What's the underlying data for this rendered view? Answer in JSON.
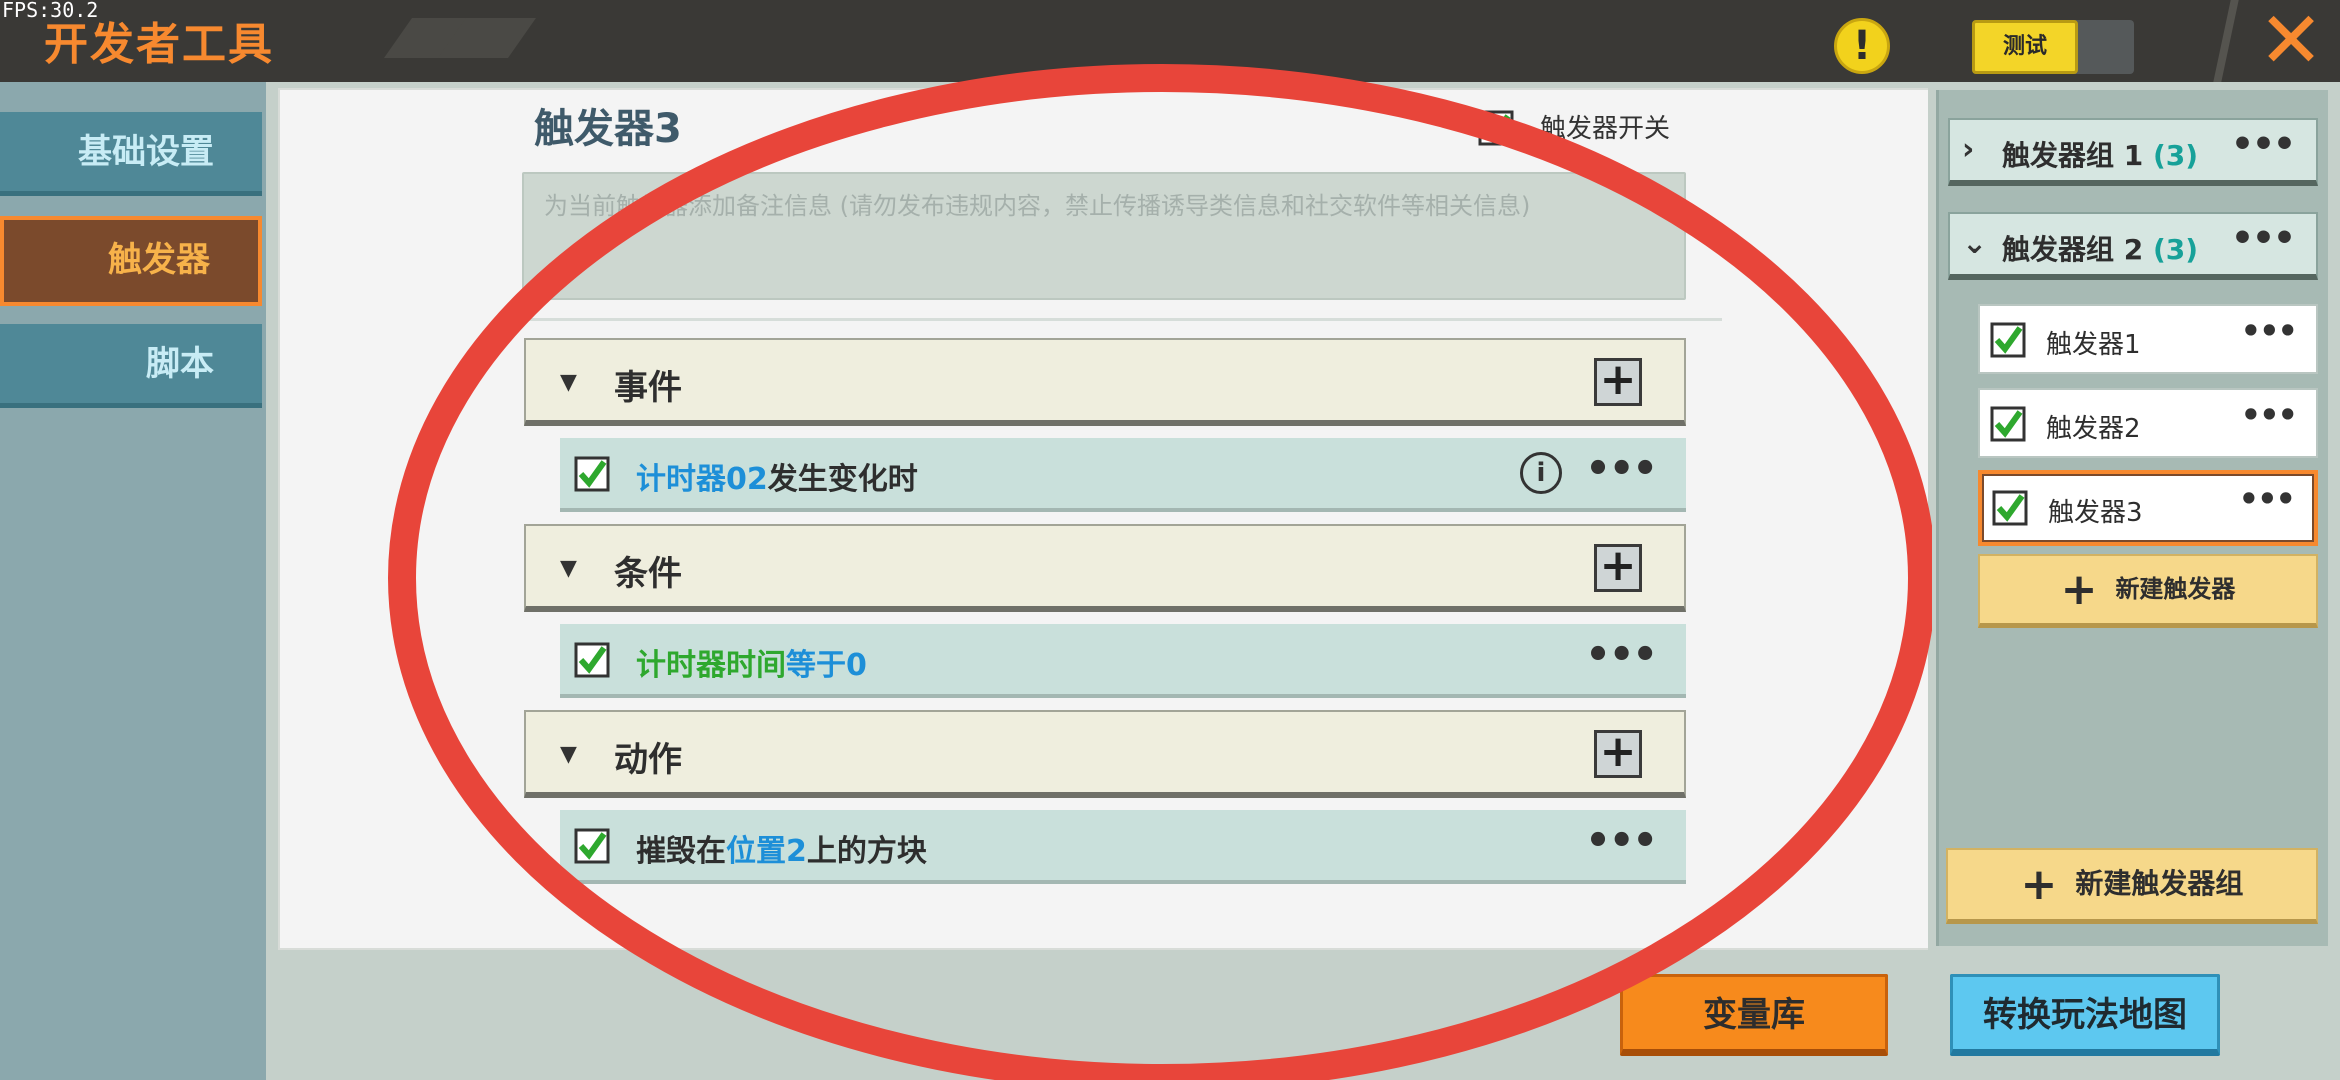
{
  "fps": "FPS:30.2",
  "app_title": "开发者工具",
  "topbar": {
    "warning_icon": "exclamation-icon",
    "test_label": "测试",
    "close_icon": "close-icon"
  },
  "nav": {
    "items": [
      {
        "label": "基础设置",
        "active": false
      },
      {
        "label": "触发器",
        "active": true
      },
      {
        "label": "脚本",
        "active": false
      }
    ]
  },
  "editor": {
    "trigger_title": "触发器3",
    "enable_label": "触发器开关",
    "note_placeholder": "为当前触发器添加备注信息 (请勿发布违规内容，禁止传播诱导类信息和社交软件等相关信息)",
    "sections": [
      {
        "label": "事件",
        "rows": [
          {
            "parts": [
              {
                "t": "计时器02",
                "c": "blue"
              },
              {
                "t": "发生变化时",
                "c": "dark"
              }
            ],
            "has_info": true
          }
        ]
      },
      {
        "label": "条件",
        "rows": [
          {
            "parts": [
              {
                "t": "计时器时间",
                "c": "green"
              },
              {
                "t": "等于",
                "c": "blue"
              },
              {
                "t": "0",
                "c": "blue"
              }
            ],
            "has_info": false
          }
        ]
      },
      {
        "label": "动作",
        "rows": [
          {
            "parts": [
              {
                "t": "摧毁在",
                "c": "dark"
              },
              {
                "t": "位置2",
                "c": "blue"
              },
              {
                "t": "上的方块",
                "c": "dark"
              }
            ],
            "has_info": false
          }
        ]
      }
    ],
    "more_glyph": "•••",
    "info_glyph": "i",
    "add_glyph": "+"
  },
  "groups": [
    {
      "label": "触发器组 1",
      "count": "(3)",
      "expanded": false
    },
    {
      "label": "触发器组 2",
      "count": "(3)",
      "expanded": true
    }
  ],
  "triggers": [
    {
      "label": "触发器1",
      "checked": true,
      "active": false
    },
    {
      "label": "触发器2",
      "checked": true,
      "active": false
    },
    {
      "label": "触发器3",
      "checked": true,
      "active": true
    }
  ],
  "new_trigger_label": "新建触发器",
  "new_group_label": "新建触发器组",
  "bottom": {
    "variable_library": "变量库",
    "switch_map": "转换玩法地图"
  },
  "colors": {
    "accent_orange": "#f7892f",
    "annotation_red": "#e8453a",
    "check_green": "#2ea82e",
    "highlight_blue": "#1d8fd8"
  }
}
